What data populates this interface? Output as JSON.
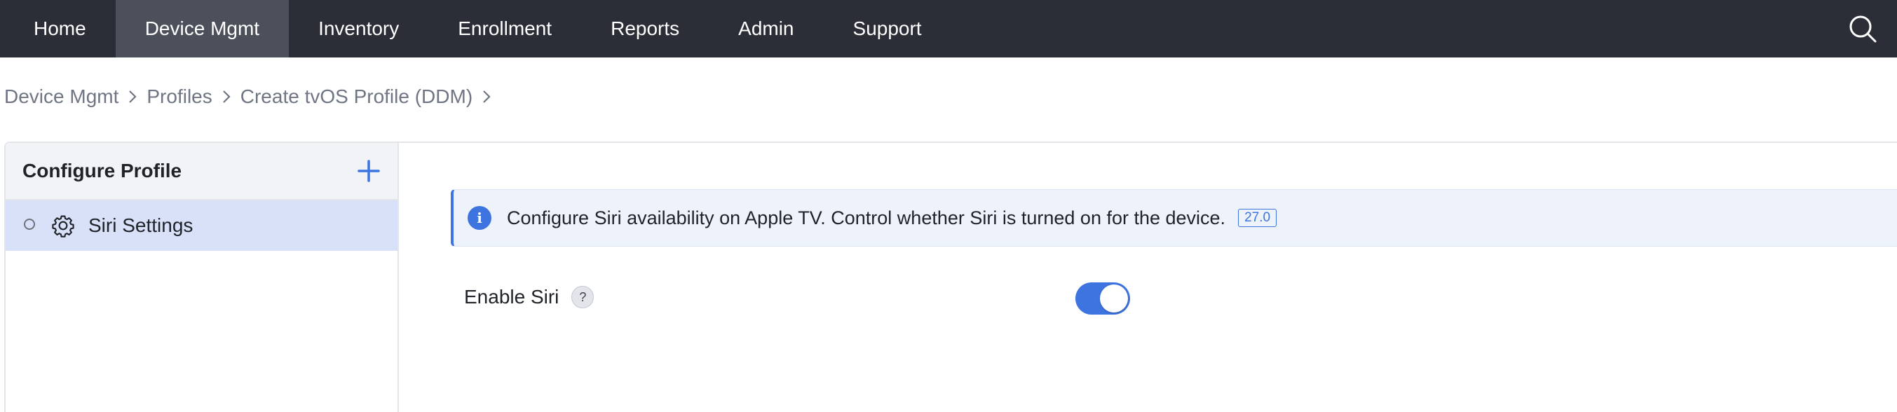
{
  "nav": {
    "items": [
      {
        "label": "Home"
      },
      {
        "label": "Device Mgmt",
        "active": true
      },
      {
        "label": "Inventory"
      },
      {
        "label": "Enrollment"
      },
      {
        "label": "Reports"
      },
      {
        "label": "Admin"
      },
      {
        "label": "Support"
      }
    ],
    "search_icon": "search-icon"
  },
  "breadcrumb": {
    "items": [
      "Device Mgmt",
      "Profiles",
      "Create tvOS Profile (DDM)"
    ],
    "separator_icon": "chevron-right-icon"
  },
  "sidebar": {
    "title": "Configure Profile",
    "add_icon": "plus-icon",
    "items": [
      {
        "label": "Siri Settings",
        "icon": "gear-icon",
        "status_icon": "status-circle-icon",
        "selected": true
      }
    ]
  },
  "content": {
    "info_banner": {
      "icon": "info-icon",
      "text": "Configure Siri availability on Apple TV. Control whether Siri is turned on for the device.",
      "badge": "27.0"
    },
    "fields": [
      {
        "label": "Enable Siri",
        "help_icon": "?",
        "value": true,
        "control": "toggle"
      }
    ]
  },
  "colors": {
    "nav_bg": "#2b2e36",
    "nav_active_bg": "#4c505b",
    "accent": "#3d74e0",
    "sidebar_selected_bg": "#d8e1f7",
    "banner_bg": "#eef2fb"
  }
}
